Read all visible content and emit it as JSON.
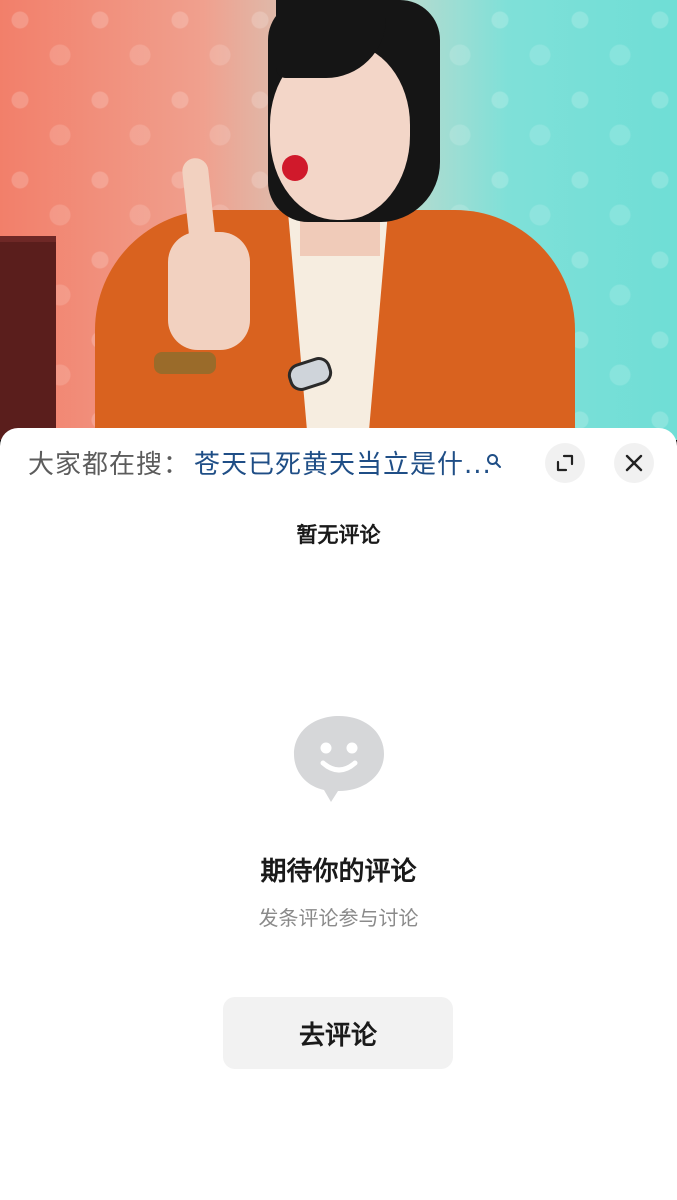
{
  "search_bar": {
    "prefix": "大家都在搜：",
    "query": "苍天已死黄天当立是什...",
    "icons": [
      "search-icon",
      "expand-icon",
      "close-icon"
    ]
  },
  "comments": {
    "header": "暂无评论",
    "empty_state": {
      "icon": "smiley-chat-bubble-icon",
      "title": "期待你的评论",
      "subtitle": "发条评论参与讨论"
    },
    "action_button_label": "去评论"
  },
  "colors": {
    "query_link": "#1f4e86",
    "prefix_text": "#5c5c5c",
    "empty_icon": "#d6d7d9",
    "button_bg": "#f2f2f2"
  }
}
